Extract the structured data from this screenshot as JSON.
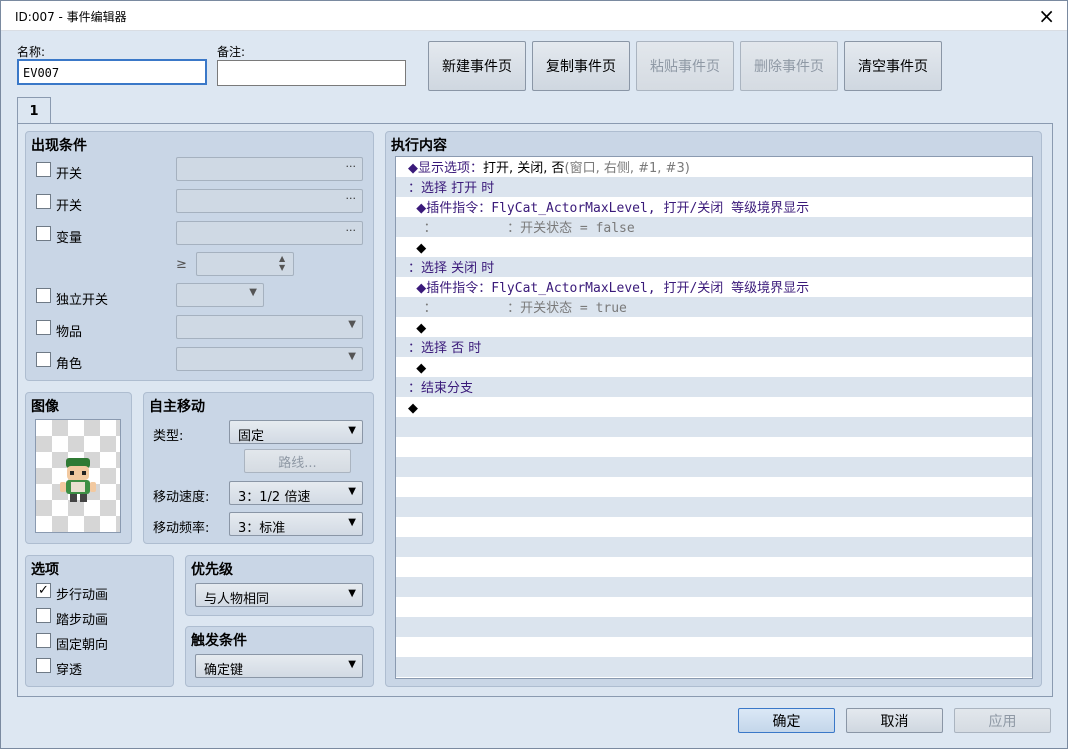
{
  "window": {
    "title": "ID:007 - 事件编辑器"
  },
  "top": {
    "name_label": "名称:",
    "name_value": "EV007",
    "note_label": "备注:",
    "note_value": "",
    "buttons": {
      "new": "新建事件页",
      "copy": "复制事件页",
      "paste": "粘贴事件页",
      "delete": "删除事件页",
      "clear": "清空事件页"
    }
  },
  "tabs": [
    {
      "label": "1"
    }
  ],
  "conditions": {
    "title": "出现条件",
    "switch1_label": "开关",
    "switch2_label": "开关",
    "variable_label": "变量",
    "gte_symbol": "≥",
    "self_switch_label": "独立开关",
    "item_label": "物品",
    "actor_label": "角色"
  },
  "image": {
    "title": "图像"
  },
  "autonomous": {
    "title": "自主移动",
    "type_label": "类型:",
    "type_value": "固定",
    "route_button": "路线...",
    "speed_label": "移动速度:",
    "speed_value": "3：1/2 倍速",
    "freq_label": "移动频率:",
    "freq_value": "3：标准"
  },
  "options": {
    "title": "选项",
    "walk": "步行动画",
    "step": "踏步动画",
    "dirfix": "固定朝向",
    "through": "穿透"
  },
  "priority": {
    "title": "优先级",
    "value": "与人物相同"
  },
  "trigger": {
    "title": "触发条件",
    "value": "确定键"
  },
  "contents": {
    "title": "执行内容",
    "rows": {
      "r0a": "◆显示选项：",
      "r0b": "打开, 关闭, 否",
      "r0c": "(窗口, 右侧, #1, #3)",
      "r1": "：选择 打开 时",
      "r2a": "  ◆插件指令：",
      "r2b": "FlyCat_ActorMaxLevel, 打开/关闭 等级境界显示",
      "r3": "  ：         ：开关状态 = false",
      "r4": "  ◆",
      "r5": "：选择 关闭 时",
      "r6a": "  ◆插件指令：",
      "r6b": "FlyCat_ActorMaxLevel, 打开/关闭 等级境界显示",
      "r7": "  ：         ：开关状态 = true",
      "r8": "  ◆",
      "r9": "：选择 否 时",
      "r10": "  ◆",
      "r11": "：结束分支",
      "r12": "◆"
    }
  },
  "footer": {
    "ok": "确定",
    "cancel": "取消",
    "apply": "应用"
  },
  "icons": {
    "close": "×",
    "dots": "···",
    "dropdown": "▼",
    "spin": "▲▼",
    "check": "✓"
  },
  "colors": {
    "accent": "#3a78c8",
    "command": "#3a1a7a"
  }
}
